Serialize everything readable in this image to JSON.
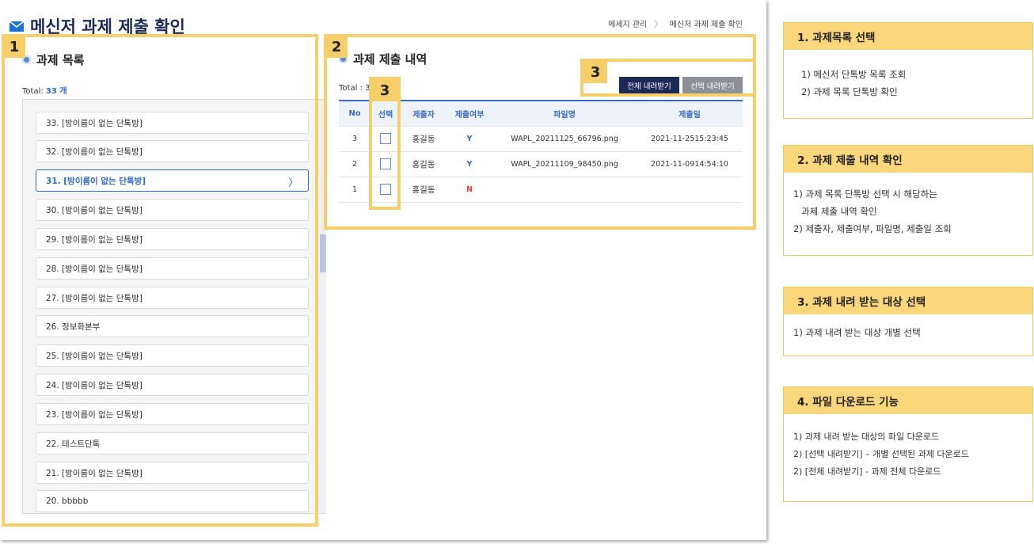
{
  "header": {
    "title": "메신저 과제 제출 확인",
    "breadcrumb": [
      "메세지 관리",
      "메신저 과제 제출 확인"
    ]
  },
  "left_panel": {
    "title": "과제 목록",
    "total_label": "Total:",
    "total_value": "33 개",
    "items": [
      {
        "label": "33. [방이름이 없는 단톡방]"
      },
      {
        "label": "32. [방이름이 없는 단톡방]"
      },
      {
        "label": "31. [방이름이 없는 단톡방]",
        "active": true
      },
      {
        "label": "30. [방이름이 없는 단톡방]"
      },
      {
        "label": "29. [방이름이 없는 단톡방]"
      },
      {
        "label": "28. [방이름이 없는 단톡방]"
      },
      {
        "label": "27. [방이름이 없는 단톡방]"
      },
      {
        "label": "26. 정보화본부"
      },
      {
        "label": "25. [방이름이 없는 단톡방]"
      },
      {
        "label": "24. [방이름이 없는 단톡방]"
      },
      {
        "label": "23. [방이름이 없는 단톡방]"
      },
      {
        "label": "22. 테스트단톡"
      },
      {
        "label": "21. [방이름이 없는 단톡방]"
      },
      {
        "label": "20. bbbbb"
      }
    ]
  },
  "right_panel": {
    "title": "과제 제출 내역",
    "total_label": "Total : 3",
    "download_all_label": "전체 내려받기",
    "download_selected_label": "선택 내려받기",
    "columns": [
      "No",
      "선택",
      "제출자",
      "제출여부",
      "파일명",
      "제출일"
    ],
    "rows": [
      {
        "no": "3",
        "submitter": "홍길동",
        "submitted": "Y",
        "filename": "WAPL_20211125_66796.png",
        "date": "2021-11-2515:23:45"
      },
      {
        "no": "2",
        "submitter": "홍길동",
        "submitted": "Y",
        "filename": "WAPL_20211109_98450.png",
        "date": "2021-11-0914:54:10"
      },
      {
        "no": "1",
        "submitter": "홍길동",
        "submitted": "N",
        "filename": "",
        "date": ""
      }
    ]
  },
  "annotations": [
    "1",
    "2",
    "3",
    "3"
  ],
  "guide": [
    {
      "title": "1. 과제목록 선택",
      "lines": [
        "1) 메신저 단톡방 목록 조회",
        "2) 과제 목록 단톡방 확인"
      ]
    },
    {
      "title": "2. 과제 제출 내역 확인",
      "lines": [
        "1) 과제 목록 단톡방 선택 시 해당하는",
        "   과제 제출 내역 확인",
        "2) 제출자, 제출여부, 파일명, 제출일 조회"
      ]
    },
    {
      "title": "3. 과제 내려 받는 대상 선택",
      "lines": [
        "1) 과제 내려 받는 대상 개별 선택"
      ]
    },
    {
      "title": "4. 파일 다운로드 기능",
      "lines": [
        "1) 과제 내려 받는 대상의 파일 다운로드",
        "2) [선택 내려받기] – 개별 선택된 과제 다운로드",
        "2) [전체 내려받기] - 과제 전체 다운로드"
      ]
    }
  ],
  "colors": {
    "accent": "#2f68c5",
    "navy": "#1d2a57",
    "highlight": "#f6cf6b",
    "guide_header": "#f9d77a"
  }
}
